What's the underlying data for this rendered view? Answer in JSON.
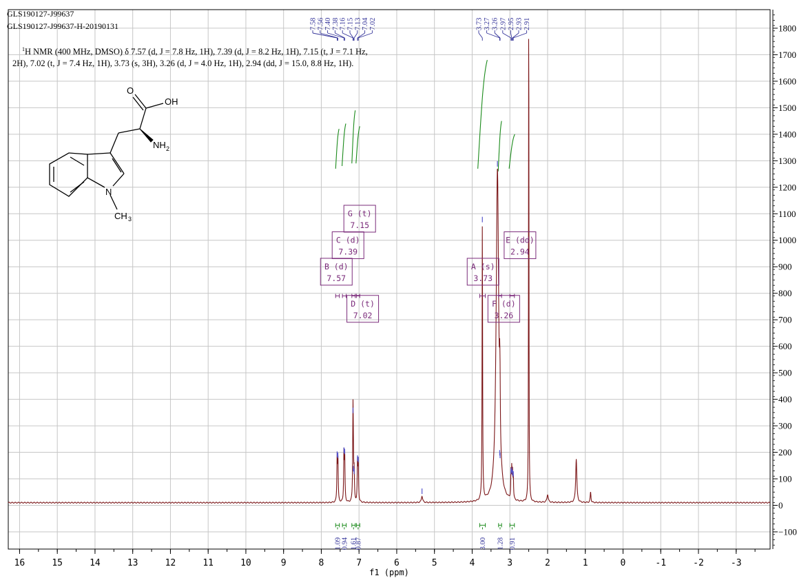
{
  "header": {
    "sample_line1": "GLS190127-J99637",
    "sample_line2": "GLS190127-J99637-H-20190131"
  },
  "description": {
    "nmr_sup": "1",
    "nmr_line1": "H NMR (400 MHz, DMSO) δ 7.57 (d, J = 7.8 Hz, 1H), 7.39 (d, J = 8.2 Hz, 1H), 7.15 (t, J = 7.1 Hz,",
    "nmr_line2": "2H), 7.02 (t, J = 7.4 Hz, 1H), 3.73 (s, 3H), 3.26 (d, J = 4.0 Hz, 1H), 2.94 (dd, J = 15.0, 8.8 Hz, 1H)."
  },
  "structure": {
    "labels": [
      "O",
      "OH",
      "NH",
      "2",
      "N",
      "CH",
      "3"
    ]
  },
  "chart_data": {
    "type": "line",
    "title": "",
    "xlabel": "f1 (ppm)",
    "ylabel": "",
    "xlim": [
      16.3,
      -3.9
    ],
    "ylim": [
      -165,
      1870
    ],
    "x_reversed": true,
    "grid": true,
    "x_ticks": [
      16,
      15,
      14,
      13,
      12,
      11,
      10,
      9,
      8,
      7,
      6,
      5,
      4,
      3,
      2,
      1,
      0,
      -1,
      -2,
      -3
    ],
    "y_ticks": [
      -100,
      0,
      100,
      200,
      300,
      400,
      500,
      600,
      700,
      800,
      900,
      1000,
      1100,
      1200,
      1300,
      1400,
      1500,
      1600,
      1700,
      1800
    ],
    "baseline": 10,
    "peaks": [
      {
        "x": 7.58,
        "y": 165,
        "w": 0.009
      },
      {
        "x": 7.56,
        "y": 160,
        "w": 0.009
      },
      {
        "x": 7.4,
        "y": 180,
        "w": 0.009
      },
      {
        "x": 7.38,
        "y": 175,
        "w": 0.009
      },
      {
        "x": 7.16,
        "y": 330,
        "w": 0.009
      },
      {
        "x": 7.15,
        "y": 110,
        "w": 0.009
      },
      {
        "x": 7.13,
        "y": 100,
        "w": 0.009
      },
      {
        "x": 7.04,
        "y": 150,
        "w": 0.009
      },
      {
        "x": 7.02,
        "y": 145,
        "w": 0.009
      },
      {
        "x": 5.33,
        "y": 25,
        "w": 0.02
      },
      {
        "x": 3.73,
        "y": 1050,
        "w": 0.008
      },
      {
        "x": 3.33,
        "y": 1260,
        "w": 0.04
      },
      {
        "x": 3.27,
        "y": 170,
        "w": 0.008
      },
      {
        "x": 3.26,
        "y": 160,
        "w": 0.008
      },
      {
        "x": 2.97,
        "y": 100,
        "w": 0.008
      },
      {
        "x": 2.95,
        "y": 105,
        "w": 0.008
      },
      {
        "x": 2.93,
        "y": 95,
        "w": 0.008
      },
      {
        "x": 2.91,
        "y": 90,
        "w": 0.008
      },
      {
        "x": 2.5,
        "y": 2000,
        "w": 0.006
      },
      {
        "x": 2.0,
        "y": 30,
        "w": 0.02
      },
      {
        "x": 1.24,
        "y": 165,
        "w": 0.018
      },
      {
        "x": 0.86,
        "y": 40,
        "w": 0.012
      }
    ],
    "peak_labels": [
      "7.58",
      "7.56",
      "7.40",
      "7.38",
      "7.16",
      "7.15",
      "7.13",
      "7.04",
      "7.02",
      "3.73",
      "3.27",
      "3.26",
      "2.97",
      "2.95",
      "2.93",
      "2.91"
    ],
    "multiplets": [
      {
        "letter": "A",
        "type": "(s)",
        "shift": "3.73",
        "x": 3.73,
        "box_x": 3.73,
        "box_y": 880,
        "range": [
          3.8,
          3.65
        ]
      },
      {
        "letter": "B",
        "type": "(d)",
        "shift": "7.57",
        "x": 7.57,
        "box_x": 7.62,
        "box_y": 880,
        "range": [
          7.62,
          7.52
        ]
      },
      {
        "letter": "C",
        "type": "(d)",
        "shift": "7.39",
        "x": 7.39,
        "box_x": 7.31,
        "box_y": 980,
        "range": [
          7.44,
          7.34
        ]
      },
      {
        "letter": "D",
        "type": "(t)",
        "shift": "7.02",
        "x": 7.02,
        "box_x": 6.92,
        "box_y": 740,
        "range": [
          7.07,
          6.98
        ]
      },
      {
        "letter": "E",
        "type": "(dd)",
        "shift": "2.94",
        "x": 2.94,
        "box_x": 2.75,
        "box_y": 980,
        "range": [
          3.0,
          2.88
        ]
      },
      {
        "letter": "F",
        "type": "(d)",
        "shift": "3.26",
        "x": 3.26,
        "box_x": 3.18,
        "box_y": 740,
        "range": [
          3.3,
          3.22
        ]
      },
      {
        "letter": "G",
        "type": "(t)",
        "shift": "7.15",
        "x": 7.15,
        "box_x": 7.0,
        "box_y": 1080,
        "range": [
          7.19,
          7.1
        ]
      }
    ],
    "integrals": [
      {
        "range": [
          7.62,
          7.52
        ],
        "value": "1.09"
      },
      {
        "range": [
          7.44,
          7.34
        ],
        "value": "0.94"
      },
      {
        "range": [
          7.19,
          7.1
        ],
        "value": "1.61"
      },
      {
        "range": [
          7.07,
          6.98
        ],
        "value": "0.87"
      },
      {
        "range": [
          3.8,
          3.65
        ],
        "value": "3.00"
      },
      {
        "range": [
          3.3,
          3.22
        ],
        "value": "1.28"
      },
      {
        "range": [
          3.0,
          2.88
        ],
        "value": "0.91"
      }
    ],
    "integral_curves": [
      {
        "x1": 7.62,
        "x2": 7.53,
        "y1": 1270,
        "y2": 1420
      },
      {
        "x1": 7.45,
        "x2": 7.35,
        "y1": 1280,
        "y2": 1440
      },
      {
        "x1": 7.19,
        "x2": 7.1,
        "y1": 1290,
        "y2": 1490
      },
      {
        "x1": 7.08,
        "x2": 6.98,
        "y1": 1290,
        "y2": 1430
      },
      {
        "x1": 3.85,
        "x2": 3.6,
        "y1": 1270,
        "y2": 1680
      },
      {
        "x1": 3.31,
        "x2": 3.22,
        "y1": 1260,
        "y2": 1450
      },
      {
        "x1": 3.02,
        "x2": 2.87,
        "y1": 1270,
        "y2": 1400
      }
    ]
  }
}
